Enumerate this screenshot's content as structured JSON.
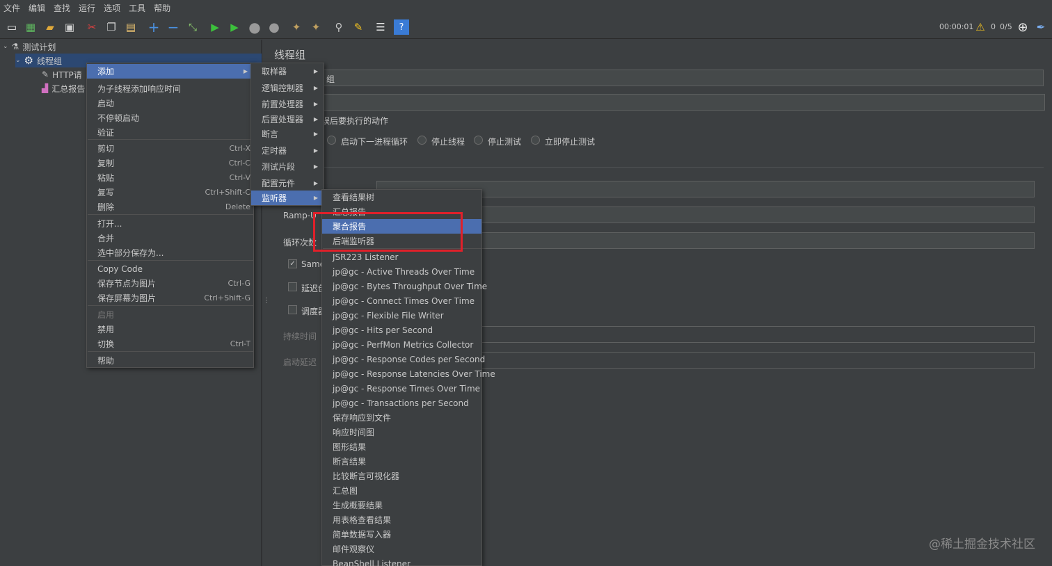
{
  "menubar": [
    "文件",
    "编辑",
    "查找",
    "运行",
    "选项",
    "工具",
    "帮助"
  ],
  "toolbar": {
    "timer": "00:00:01",
    "warnings": "0",
    "threads": "0/5"
  },
  "tree": {
    "root": "测试计划",
    "thread_group": "线程组",
    "http_request": "HTTP请",
    "summary_report": "汇总报告"
  },
  "panel": {
    "title": "线程组",
    "name_value": "组",
    "after_error_label": "误后要执行的动作",
    "radio_options": [
      "启动下一进程循环",
      "停止线程",
      "停止测试",
      "立即停止测试"
    ],
    "ramp_up_label": "Ramp-U",
    "loop_label": "循环次数",
    "same_user_label": "Same",
    "delay_label": "延迟创",
    "scheduler_label": "调度器",
    "duration_label": "持续时间",
    "startup_delay_label": "启动延迟"
  },
  "context_menu": [
    {
      "label": "添加",
      "submenu": true,
      "selected": true
    },
    {
      "label": "为子线程添加响应时间"
    },
    {
      "label": "启动"
    },
    {
      "label": "不停顿启动"
    },
    {
      "label": "验证"
    },
    {
      "label": "剪切",
      "shortcut": "Ctrl-X"
    },
    {
      "label": "复制",
      "shortcut": "Ctrl-C"
    },
    {
      "label": "粘贴",
      "shortcut": "Ctrl-V"
    },
    {
      "label": "复写",
      "shortcut": "Ctrl+Shift-C"
    },
    {
      "label": "删除",
      "shortcut": "Delete"
    },
    {
      "label": "打开..."
    },
    {
      "label": "合并"
    },
    {
      "label": "选中部分保存为..."
    },
    {
      "label": "Copy Code"
    },
    {
      "label": "保存节点为图片",
      "shortcut": "Ctrl-G"
    },
    {
      "label": "保存屏幕为图片",
      "shortcut": "Ctrl+Shift-G"
    },
    {
      "label": "启用",
      "disabled": true
    },
    {
      "label": "禁用"
    },
    {
      "label": "切换",
      "shortcut": "Ctrl-T"
    },
    {
      "label": "帮助"
    }
  ],
  "add_submenu": [
    {
      "label": "取样器"
    },
    {
      "label": "逻辑控制器"
    },
    {
      "label": "前置处理器"
    },
    {
      "label": "后置处理器"
    },
    {
      "label": "断言"
    },
    {
      "label": "定时器"
    },
    {
      "label": "测试片段"
    },
    {
      "label": "配置元件"
    },
    {
      "label": "监听器",
      "selected": true
    }
  ],
  "listener_submenu": [
    {
      "label": "查看结果树"
    },
    {
      "label": "汇总报告"
    },
    {
      "label": "聚合报告",
      "selected": true
    },
    {
      "label": "后端监听器"
    },
    {
      "label": "JSR223 Listener"
    },
    {
      "label": "jp@gc - Active Threads Over Time"
    },
    {
      "label": "jp@gc - Bytes Throughput Over Time"
    },
    {
      "label": "jp@gc - Connect Times Over Time"
    },
    {
      "label": "jp@gc - Flexible File Writer"
    },
    {
      "label": "jp@gc - Hits per Second"
    },
    {
      "label": "jp@gc - PerfMon Metrics Collector"
    },
    {
      "label": "jp@gc - Response Codes per Second"
    },
    {
      "label": "jp@gc - Response Latencies Over Time"
    },
    {
      "label": "jp@gc - Response Times Over Time"
    },
    {
      "label": "jp@gc - Transactions per Second"
    },
    {
      "label": "保存响应到文件"
    },
    {
      "label": "响应时间图"
    },
    {
      "label": "图形结果"
    },
    {
      "label": "断言结果"
    },
    {
      "label": "比较断言可视化器"
    },
    {
      "label": "汇总图"
    },
    {
      "label": "生成概要结果"
    },
    {
      "label": "用表格查看结果"
    },
    {
      "label": "简单数据写入器"
    },
    {
      "label": "邮件观察仪"
    },
    {
      "label": "BeanShell Listener"
    }
  ],
  "watermark": "@稀土掘金技术社区",
  "colors": {
    "background": "#3c3f41",
    "selection": "#4b6eaf",
    "highlight_box": "#e0202a"
  }
}
